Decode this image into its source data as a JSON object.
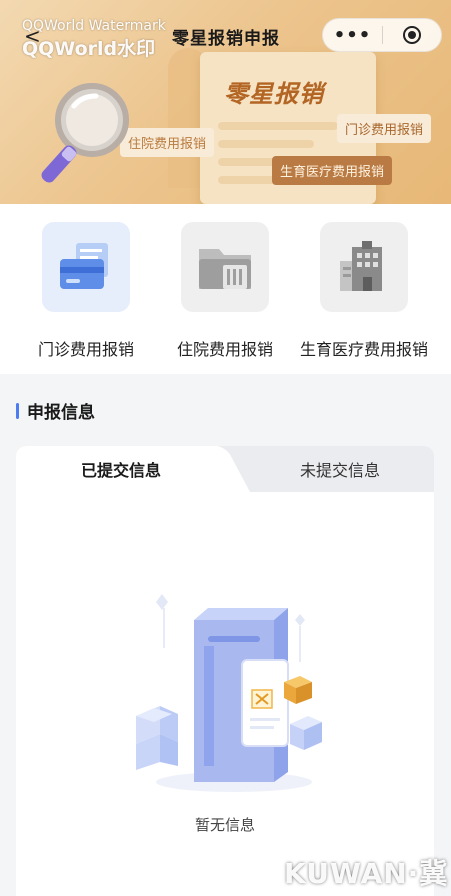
{
  "window": {
    "title": "零星报销申报"
  },
  "nav": {
    "back_glyph": "<",
    "more_glyph": "•••"
  },
  "watermark": {
    "line1": "QQWorld Watermark",
    "line2": "QQWorld水印",
    "corner": "KUWAN·冀云"
  },
  "banner": {
    "title": "零星报销",
    "tags": {
      "outpatient": "门诊费用报销",
      "inpatient": "住院费用报销",
      "maternity": "生育医疗费用报销"
    }
  },
  "services": {
    "items": [
      {
        "label": "门诊费用报销",
        "icon": "outpatient-card-icon"
      },
      {
        "label": "住院费用报销",
        "icon": "inpatient-folder-icon"
      },
      {
        "label": "生育医疗费用报销",
        "icon": "hospital-building-icon"
      }
    ]
  },
  "section": {
    "title": "申报信息"
  },
  "tabs": {
    "submitted": "已提交信息",
    "unsubmitted": "未提交信息"
  },
  "empty": {
    "text": "暂无信息",
    "icon": "empty-document-icon"
  },
  "colors": {
    "accent": "#4d7cf0",
    "banner": "#ecc48d",
    "banner_text": "#b36524"
  }
}
